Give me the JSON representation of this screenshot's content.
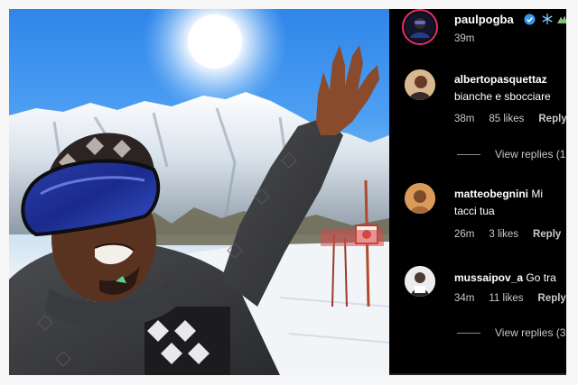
{
  "post": {
    "username": "paulpogba",
    "time": "39m"
  },
  "comments": [
    {
      "username": "albertopasquettaz",
      "text": "bianche e sbocciare",
      "time": "38m",
      "likes": "85 likes",
      "reply": "Reply",
      "view_replies": "View replies (1"
    },
    {
      "username": "matteobegnini",
      "text_inline": "Mi",
      "text": "tacci tua",
      "time": "26m",
      "likes": "3 likes",
      "reply": "Reply"
    },
    {
      "username": "mussaipov_a",
      "text_inline": "Go tra",
      "time": "34m",
      "likes": "11 likes",
      "reply": "Reply",
      "view_replies": "View replies (3"
    }
  ],
  "icons": [
    "verified-badge-icon",
    "snowflake-icon",
    "mountain-icon"
  ],
  "colors": {
    "panel_bg": "#000000",
    "verified": "#3897f0",
    "sky": "#2f86ea"
  }
}
